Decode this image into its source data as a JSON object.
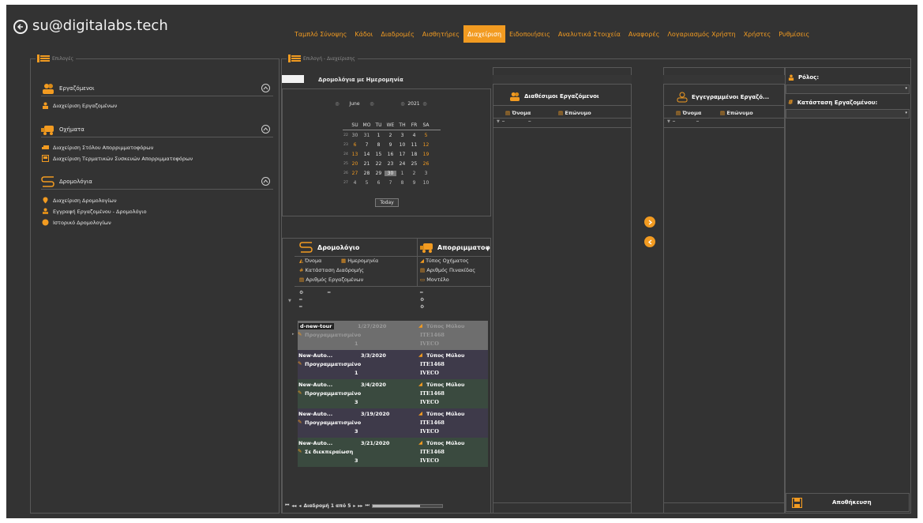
{
  "header": {
    "user": "su@digitalabs.tech",
    "nav": [
      {
        "label": "Ταμπλό Σύνοψης",
        "active": false
      },
      {
        "label": "Κάδοι",
        "active": false
      },
      {
        "label": "Διαδρομές",
        "active": false
      },
      {
        "label": "Αισθητήρες",
        "active": false
      },
      {
        "label": "Διαχείριση",
        "active": true
      },
      {
        "label": "Ειδοποιήσεις",
        "active": false
      },
      {
        "label": "Αναλυτικά Στοιχεία",
        "active": false
      },
      {
        "label": "Αναφορές",
        "active": false
      },
      {
        "label": "Λογαριασμός Χρήστη",
        "active": false
      },
      {
        "label": "Χρήστες",
        "active": false
      },
      {
        "label": "Ρυθμίσεις",
        "active": false
      }
    ]
  },
  "options": {
    "title": "Επιλογές",
    "sections": [
      {
        "label": "Εργαζόμενοι",
        "items": [
          "Διαχείριση Εργαζομένων"
        ]
      },
      {
        "label": "Οχήματα",
        "items": [
          "Διαχείριση Στόλου Απορριμματοφόρων",
          "Διαχείριση Τερματικών Συσκευών Απορριμματοφόρων"
        ]
      },
      {
        "label": "Δρομολόγια",
        "items": [
          "Διαχείριση Δρομολογίων",
          "Εγγραφή Εργαζομένου - Δρομολόγιο",
          "Ιστορικό Δρομολογίων"
        ]
      }
    ]
  },
  "manage": {
    "title": "Επιλογή - Διαχείρισης",
    "date_toggle_label": "Δρομολόγια με Ημερομηνία",
    "calendar": {
      "month": "June",
      "year": "2021",
      "weekdays": [
        "SU",
        "MO",
        "TU",
        "WE",
        "TH",
        "FR",
        "SA"
      ],
      "weeks": [
        {
          "wk": "22",
          "days": [
            "30",
            "31",
            "1",
            "2",
            "3",
            "4",
            "5"
          ]
        },
        {
          "wk": "23",
          "days": [
            "6",
            "7",
            "8",
            "9",
            "10",
            "11",
            "12"
          ]
        },
        {
          "wk": "24",
          "days": [
            "13",
            "14",
            "15",
            "16",
            "17",
            "18",
            "19"
          ]
        },
        {
          "wk": "25",
          "days": [
            "20",
            "21",
            "22",
            "23",
            "24",
            "25",
            "26"
          ]
        },
        {
          "wk": "26",
          "days": [
            "27",
            "28",
            "29",
            "30",
            "1",
            "2",
            "3"
          ]
        },
        {
          "wk": "27",
          "days": [
            "4",
            "5",
            "6",
            "7",
            "8",
            "9",
            "10"
          ]
        }
      ],
      "selected": "30",
      "today_label": "Today"
    },
    "routes_table": {
      "col_route": "Δρομολόγιο",
      "col_truck": "Απορριμματοφ",
      "fields_left": [
        "Όνομα",
        "Ημερομηνία",
        "Κατάσταση Διαδρομής",
        "Αριθμός Εργαζομένων"
      ],
      "fields_right": [
        "Τύπος Οχήματος",
        "Αριθμός Πινακίδας",
        "Μοντέλο"
      ],
      "rows": [
        {
          "name": "d-new-tour",
          "date": "1/27/2020",
          "status": "Προγραμματισμένο",
          "count": "1",
          "vehicle": "Τύπος Μύλου",
          "plate": "ΙΤΕ1468",
          "model": "IVECO"
        },
        {
          "name": "New-Auto...",
          "date": "3/3/2020",
          "status": "Προγραμματισμένο",
          "count": "1",
          "vehicle": "Τύπος Μύλου",
          "plate": "ΙΤΕ1468",
          "model": "IVECO"
        },
        {
          "name": "New-Auto...",
          "date": "3/4/2020",
          "status": "Προγραμματισμένο",
          "count": "3",
          "vehicle": "Τύπος Μύλου",
          "plate": "ΙΤΕ1468",
          "model": "IVECO"
        },
        {
          "name": "New-Auto...",
          "date": "3/19/2020",
          "status": "Προγραμματισμένο",
          "count": "3",
          "vehicle": "Τύπος Μύλου",
          "plate": "ΙΤΕ1468",
          "model": "IVECO"
        },
        {
          "name": "New-Auto...",
          "date": "3/21/2020",
          "status": "Σε διεκπεραίωση",
          "count": "3",
          "vehicle": "Τύπος Μύλου",
          "plate": "ΙΤΕ1468",
          "model": "IVECO"
        }
      ],
      "pager": "Διαδρομή 1 από 5"
    },
    "available": {
      "title": "Διαθέσιμοι Εργαζόμενοι",
      "col_first": "Όνομα",
      "col_last": "Επώνυμο"
    },
    "enrolled": {
      "title": "Εγγεγραμμένοι Εργαζό...",
      "col_first": "Όνομα",
      "col_last": "Επώνυμο"
    },
    "props": {
      "role_label": "Ρόλος:",
      "status_label": "Κατάσταση Εργαζομένου:",
      "save_label": "Αποθήκευση"
    }
  },
  "colors": {
    "accent": "#f29b21",
    "bg": "#333333",
    "border": "#595959"
  }
}
